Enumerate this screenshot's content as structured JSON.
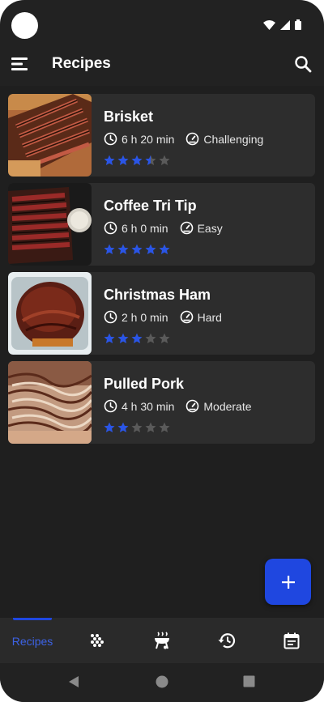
{
  "app": {
    "title": "Recipes",
    "accent_color": "#1f47e0",
    "star_filled_color": "#2a55e6",
    "star_empty_color": "#5a5a5a"
  },
  "appbar": {
    "menu_icon": "menu-icon",
    "search_icon": "search-icon"
  },
  "recipes": [
    {
      "name": "Brisket",
      "time": "6 h 20 min",
      "difficulty": "Challenging",
      "rating": 3.5,
      "max_rating": 5
    },
    {
      "name": "Coffee Tri Tip",
      "time": "6 h 0 min",
      "difficulty": "Easy",
      "rating": 5,
      "max_rating": 5
    },
    {
      "name": "Christmas Ham",
      "time": "2 h 0 min",
      "difficulty": "Hard",
      "rating": 3,
      "max_rating": 5
    },
    {
      "name": "Pulled Pork",
      "time": "4 h 30 min",
      "difficulty": "Moderate",
      "rating": 2,
      "max_rating": 5
    }
  ],
  "fab": {
    "icon": "plus-icon"
  },
  "bottom_nav": {
    "items": [
      {
        "label": "Recipes",
        "icon": "recipes-tab",
        "active": true
      },
      {
        "icon": "seasoning-icon"
      },
      {
        "icon": "grill-icon"
      },
      {
        "icon": "history-icon"
      },
      {
        "icon": "calendar-icon"
      }
    ]
  },
  "system_nav": {
    "back_icon": "back-icon",
    "home_icon": "home-icon",
    "recents_icon": "recents-icon"
  }
}
